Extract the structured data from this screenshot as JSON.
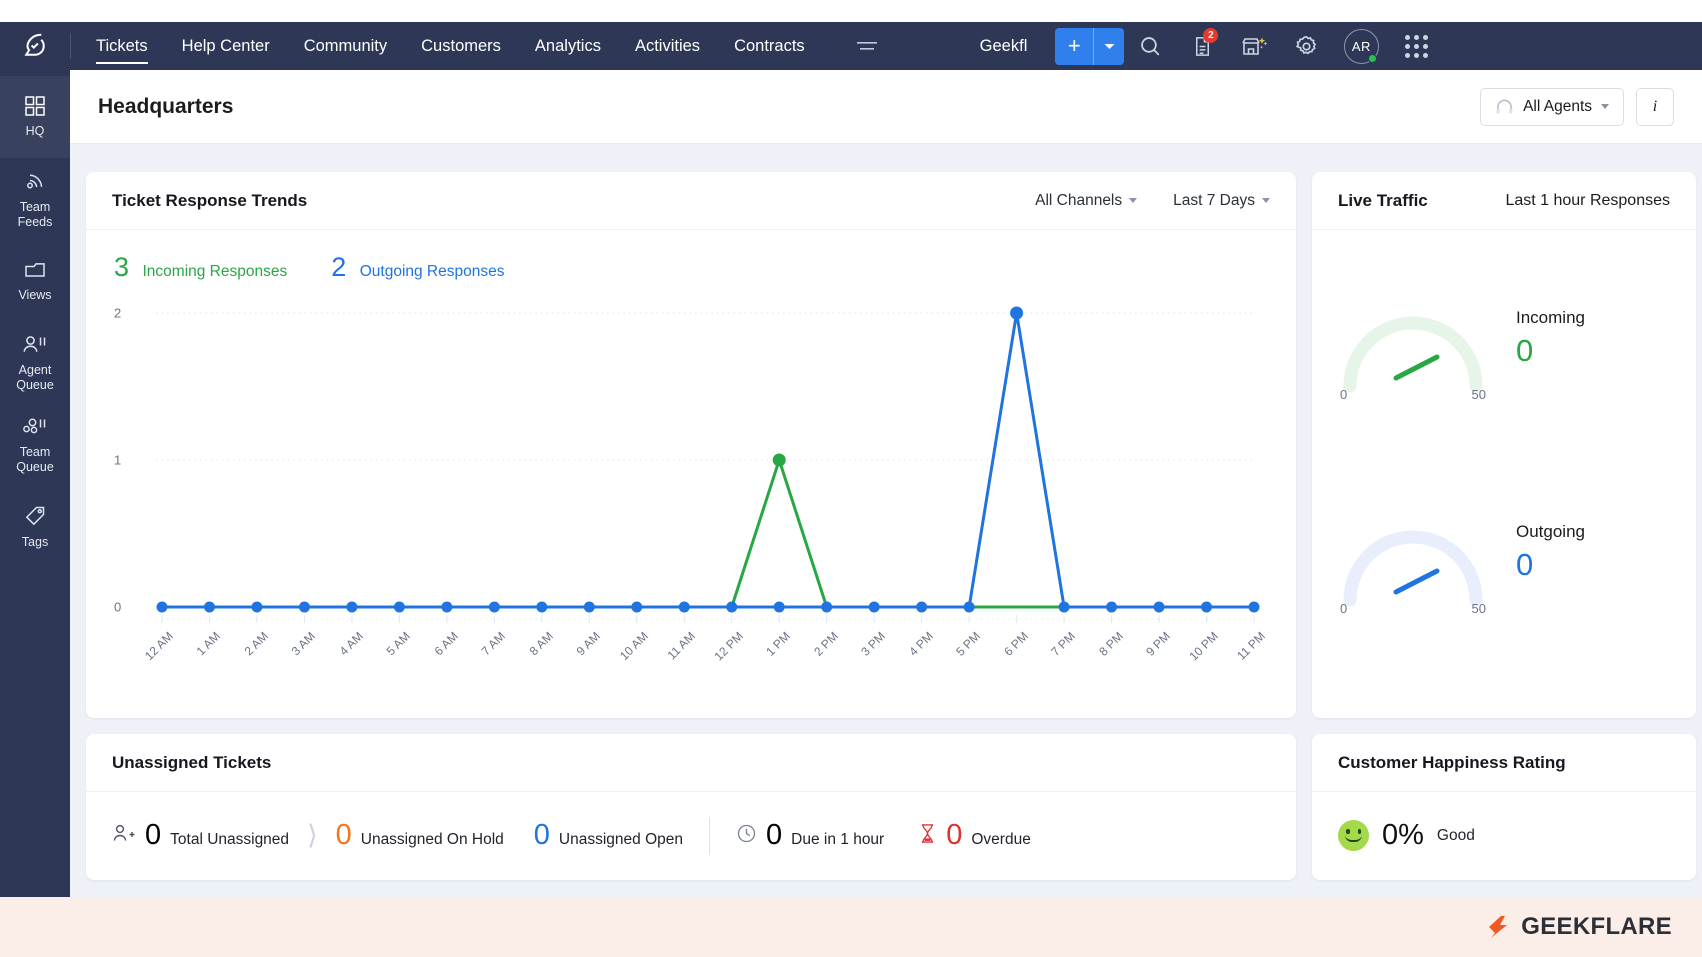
{
  "topnav": {
    "logo": "zoho-desk-logo-icon",
    "items": [
      {
        "label": "Tickets",
        "active": true
      },
      {
        "label": "Help Center",
        "active": false
      },
      {
        "label": "Community",
        "active": false
      },
      {
        "label": "Customers",
        "active": false
      },
      {
        "label": "Analytics",
        "active": false
      },
      {
        "label": "Activities",
        "active": false
      },
      {
        "label": "Contracts",
        "active": false
      }
    ],
    "collapse_icon": "hamburger-collapse-icon",
    "org_name": "Geekfl",
    "add_button": {
      "label": "+",
      "caret": "chevron-down-icon",
      "color": "#2f80ed"
    },
    "icons": [
      {
        "name": "search-icon"
      },
      {
        "name": "notes-icon",
        "badge": "2"
      },
      {
        "name": "marketplace-icon"
      },
      {
        "name": "settings-gear-icon"
      }
    ],
    "avatar": {
      "initials": "AR",
      "status": "online"
    },
    "apps_icon": "apps-grid-icon"
  },
  "rail": {
    "items": [
      {
        "label": "HQ",
        "icon": "grid-squares-icon",
        "active": true
      },
      {
        "label": "Team\nFeeds",
        "line1": "Team",
        "line2": "Feeds",
        "icon": "feed-icon",
        "active": false
      },
      {
        "label": "Views",
        "line1": "Views",
        "line2": "",
        "icon": "folder-icon",
        "active": false
      },
      {
        "label": "Agent Queue",
        "line1": "Agent",
        "line2": "Queue",
        "icon": "agent-icon",
        "active": false
      },
      {
        "label": "Team Queue",
        "line1": "Team",
        "line2": "Queue",
        "icon": "team-icon",
        "active": false
      },
      {
        "label": "Tags",
        "line1": "Tags",
        "line2": "",
        "icon": "tag-icon",
        "active": false
      }
    ]
  },
  "page": {
    "title": "Headquarters",
    "agents_filter": {
      "label": "All Agents",
      "icon": "headset-icon",
      "caret": "chevron-down-icon"
    },
    "info_button": "i"
  },
  "trends": {
    "title": "Ticket Response Trends",
    "channel_filter": "All Channels",
    "range_filter": "Last 7 Days",
    "incoming_value": "3",
    "incoming_label": "Incoming Responses",
    "outgoing_value": "2",
    "outgoing_label": "Outgoing Responses",
    "incoming_color": "#27a844",
    "outgoing_color": "#1f74e0"
  },
  "chart_data": {
    "type": "line",
    "title": "Ticket Response Trends",
    "xlabel": "",
    "ylabel": "",
    "ylim": [
      0,
      2
    ],
    "yticks": [
      0,
      1,
      2
    ],
    "grid": true,
    "legend": "top-left",
    "categories": [
      "12 AM",
      "1 AM",
      "2 AM",
      "3 AM",
      "4 AM",
      "5 AM",
      "6 AM",
      "7 AM",
      "8 AM",
      "9 AM",
      "10 AM",
      "11 AM",
      "12 PM",
      "1 PM",
      "2 PM",
      "3 PM",
      "4 PM",
      "5 PM",
      "6 PM",
      "7 PM",
      "8 PM",
      "9 PM",
      "10 PM",
      "11 PM"
    ],
    "series": [
      {
        "name": "Incoming Responses",
        "color": "#27a844",
        "values": [
          0,
          0,
          0,
          0,
          0,
          0,
          0,
          0,
          0,
          0,
          0,
          0,
          0,
          1,
          0,
          0,
          0,
          0,
          0,
          0,
          0,
          0,
          0,
          0
        ]
      },
      {
        "name": "Outgoing Responses",
        "color": "#1f74e0",
        "values": [
          0,
          0,
          0,
          0,
          0,
          0,
          0,
          0,
          0,
          0,
          0,
          0,
          0,
          0,
          0,
          0,
          0,
          0,
          2,
          0,
          0,
          0,
          0,
          0
        ]
      }
    ]
  },
  "live_traffic": {
    "title": "Live Traffic",
    "subtitle": "Last 1 hour Responses",
    "gauges": [
      {
        "name": "Incoming",
        "value": "0",
        "min": "0",
        "max": "50",
        "color": "#27a844",
        "track": "#e7f5e9"
      },
      {
        "name": "Outgoing",
        "value": "0",
        "min": "0",
        "max": "50",
        "color": "#1f74e0",
        "track": "#e8eefb"
      }
    ]
  },
  "unassigned": {
    "title": "Unassigned Tickets",
    "stats": [
      {
        "icon": "add-user-icon",
        "value": "0",
        "label": "Total Unassigned",
        "color": "#000000"
      },
      {
        "icon": "",
        "value": "0",
        "label": "Unassigned On Hold",
        "color": "#f2761b"
      },
      {
        "icon": "",
        "value": "0",
        "label": "Unassigned Open",
        "color": "#1f74e0"
      },
      {
        "icon": "clock-icon",
        "value": "0",
        "label": "Due in 1 hour",
        "color": "#000000"
      },
      {
        "icon": "hourglass-icon",
        "value": "0",
        "label": "Overdue",
        "color": "#e03131"
      }
    ]
  },
  "happiness": {
    "title": "Customer Happiness Rating",
    "percent": "0%",
    "label": "Good",
    "icon": "happy-face-icon"
  },
  "footer": {
    "brand": "GEEKFLARE",
    "logo": "geekflare-logo-icon",
    "brand_color": "#f05a22"
  }
}
